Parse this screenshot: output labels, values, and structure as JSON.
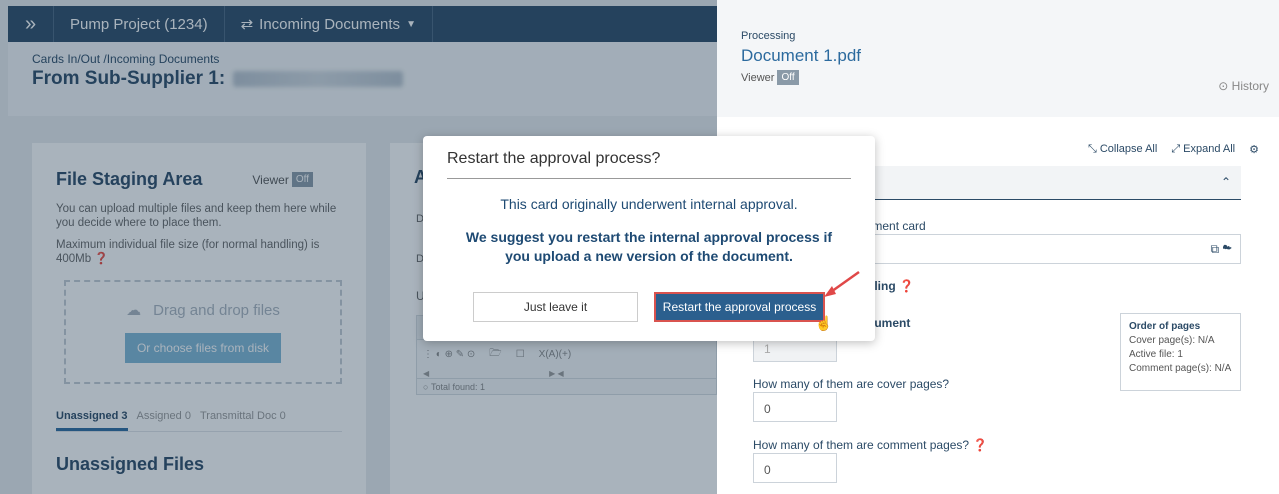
{
  "breadcrumb": {
    "project": "Pump Project (1234)",
    "section": "Incoming Documents"
  },
  "page_header": {
    "path": "Cards In/Out /Incoming Documents",
    "title": "From Sub-Supplier 1:"
  },
  "staging": {
    "title": "File Staging Area",
    "viewer_label": "Viewer",
    "viewer_state": "Off",
    "desc1": "You can upload multiple files and keep them here while you decide where to place them.",
    "desc2": "Maximum individual file size (for normal handling) is 400Mb",
    "dropzone_text": "Drag and drop files",
    "choose_button": "Or choose files from disk",
    "tabs": [
      "Unassigned 3",
      "Assigned 0",
      "Transmittal Doc 0"
    ],
    "section_title": "Unassigned Files"
  },
  "middle_card": {
    "title_initial": "A",
    "grid_cols": "X(A)(+)",
    "total_found": "Total found: 1"
  },
  "processing": {
    "label": "Processing",
    "document": "Document 1.pdf",
    "viewer_label": "Viewer",
    "viewer_state": "Off",
    "history": "History",
    "collapse_all": "Collapse All",
    "expand_all": "Expand All",
    "doc_card_label": "ocument card",
    "handling_label": "andling",
    "document_label": "document",
    "pages_value": "1",
    "cover_label": "How many of them are cover pages?",
    "cover_value": "0",
    "comment_label": "How many of them are comment pages?",
    "comment_value": "0",
    "order": {
      "title": "Order of pages",
      "cover": "Cover page(s): N/A",
      "active": "Active file: 1",
      "comment": "Comment page(s): N/A"
    }
  },
  "modal": {
    "title": "Restart the approval process?",
    "message1": "This card originally underwent internal approval.",
    "message2": "We suggest you restart the internal approval process if you upload a new version of the document.",
    "leave_button": "Just leave it",
    "restart_button": "Restart the approval process"
  },
  "colors": {
    "primary": "#2b4a66",
    "accent_button": "#2b5f8e",
    "highlight": "#d9534f"
  }
}
